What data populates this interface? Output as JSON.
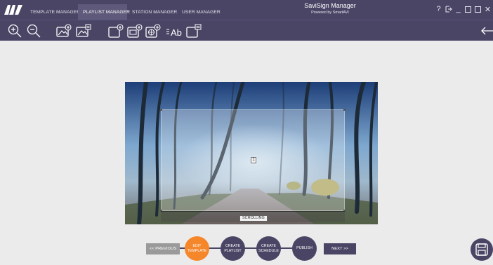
{
  "logo": {
    "text": "AVI"
  },
  "tabs": [
    {
      "label": "TEMPLATE MANAGER"
    },
    {
      "label": "PLAYLIST MANAGER"
    },
    {
      "label": "STATION MANAGER"
    },
    {
      "label": "USER MANAGER"
    }
  ],
  "active_tab": 1,
  "app": {
    "title": "SaviSign Manager",
    "subtitle": "Powered by SmartAVI"
  },
  "window_controls": {
    "help": "?",
    "logout": "↦",
    "minimize": "_",
    "restore": "☐",
    "maximize": "☐",
    "close": "✕"
  },
  "toolbar": {
    "icons": [
      "zoom-in-icon",
      "zoom-out-icon",
      "add-image-icon",
      "add-image-playlist-icon",
      "add-zone-icon",
      "add-video-zone-icon",
      "add-web-zone-icon",
      "add-text-zone-icon",
      "add-scheduled-zone-icon",
      "back-arrow-icon"
    ],
    "text_tool_label": "Ab"
  },
  "canvas": {
    "zone_number": "1",
    "scrolling_label": "SCROLLING"
  },
  "wizard": {
    "prev_label": "<< PREVIOUS",
    "next_label": "NEXT >>",
    "steps": [
      {
        "label": "EDIT\nTEMPLATE"
      },
      {
        "label": "CREATE\nPLAYLIST"
      },
      {
        "label": "CREATE\nSCHEDULE"
      },
      {
        "label": "PUBLISH"
      }
    ],
    "active_step": 0
  },
  "colors": {
    "chrome": "#4a4565",
    "accent": "#f5862a",
    "background": "#ebebeb"
  }
}
